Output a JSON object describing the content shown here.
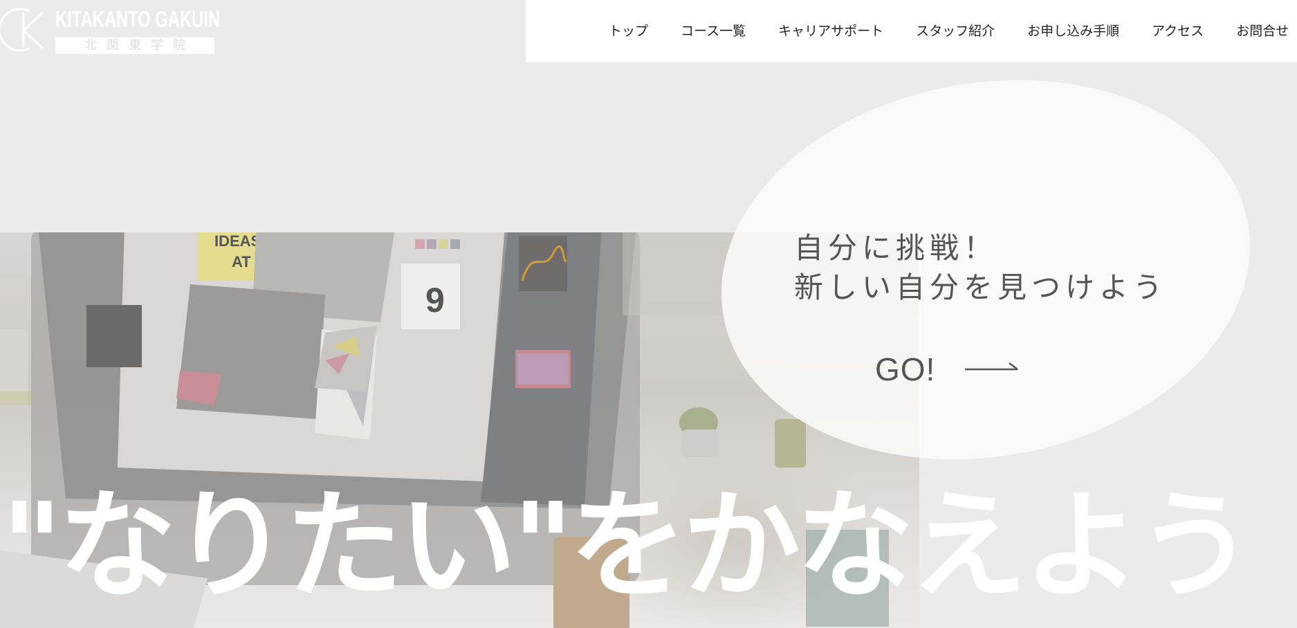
{
  "logo": {
    "en": "KITAKANTO GAKUIN",
    "jp": "北関東学院",
    "mark": "kg-logo-mark"
  },
  "nav": {
    "items": [
      {
        "label": "トップ"
      },
      {
        "label": "コース一覧"
      },
      {
        "label": "キャリアサポート"
      },
      {
        "label": "スタッフ紹介"
      },
      {
        "label": "お申し込み手順"
      },
      {
        "label": "アクセス"
      },
      {
        "label": "お問合せ"
      }
    ]
  },
  "hero": {
    "copy_line1": "自分に挑戦！",
    "copy_line2": "新しい自分を見つけよう",
    "go_label": "GO!",
    "arrow_icon": "long-right-arrow-icon",
    "tagline": "\"なりたい\"をかなえよう"
  },
  "colors": {
    "background": "#ebebeb",
    "nav_bg": "#ffffff",
    "nav_text": "#222222",
    "copy_text": "#555555",
    "tagline": "#ffffff"
  }
}
